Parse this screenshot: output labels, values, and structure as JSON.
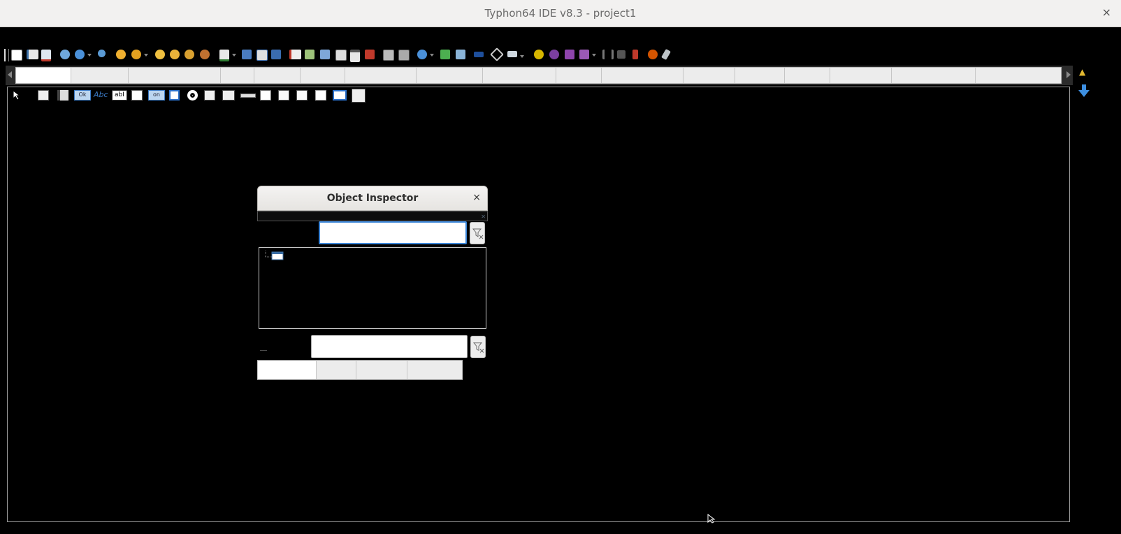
{
  "window": {
    "title": "Typhon64 IDE v8.3 - project1",
    "close_glyph": "×"
  },
  "main_toolbar": {
    "icons": [
      "new-file-icon",
      "new-form-icon",
      "new-unit-icon",
      "open-icon",
      "open-recent-icon",
      "find-icon",
      "find-in-files-icon",
      "search-again-icon",
      "add-to-project-icon",
      "remove-from-project-icon",
      "inspect-icon",
      "bug-icon",
      "jump-icon",
      "save-icon",
      "save-as-icon",
      "save-all-icon",
      "view-units-icon",
      "view-forms-icon",
      "toggle-form-unit-icon",
      "components-icon",
      "messages-icon",
      "binoculars-icon",
      "build-icon",
      "compile-icon",
      "run-icon",
      "debug-icon",
      "tools-icon",
      "monitor-icon",
      "settings-gear-icon",
      "purple-gear-icon",
      "run-play-icon",
      "step-icon",
      "pause-icon",
      "stop-icon",
      "step-into-icon",
      "step-over-icon",
      "step-out-icon"
    ]
  },
  "palette_tabs": {
    "count": 17,
    "active_index": 0
  },
  "component_palette": {
    "icons": [
      "pointer-icon",
      "main-menu-icon",
      "popup-menu-icon",
      "button-icon",
      "label-icon",
      "edit-icon",
      "memo-icon",
      "toggle-box-icon",
      "checkbox-icon",
      "radio-button-icon",
      "listbox-icon",
      "combobox-icon",
      "scrollbar-icon",
      "groupbox-icon",
      "radio-group-icon",
      "checkgroup-icon",
      "panel-icon",
      "frame-icon",
      "action-list-icon"
    ],
    "button_text": "Ok",
    "label_text": "Abc",
    "edit_text": "abI",
    "toggle_text": "on"
  },
  "object_inspector": {
    "title": "Object Inspector",
    "close_glyph": "×",
    "component_filter": {
      "value": "",
      "placeholder": ""
    },
    "property_filter": {
      "value": "",
      "placeholder": ""
    },
    "tabs": [
      {
        "label": ""
      },
      {
        "label": ""
      },
      {
        "label": ""
      },
      {
        "label": ""
      }
    ],
    "active_tab": 0
  },
  "colors": {
    "background": "#000000",
    "titlebar": "#f2f1f0",
    "focus_border": "#3b86d9"
  }
}
